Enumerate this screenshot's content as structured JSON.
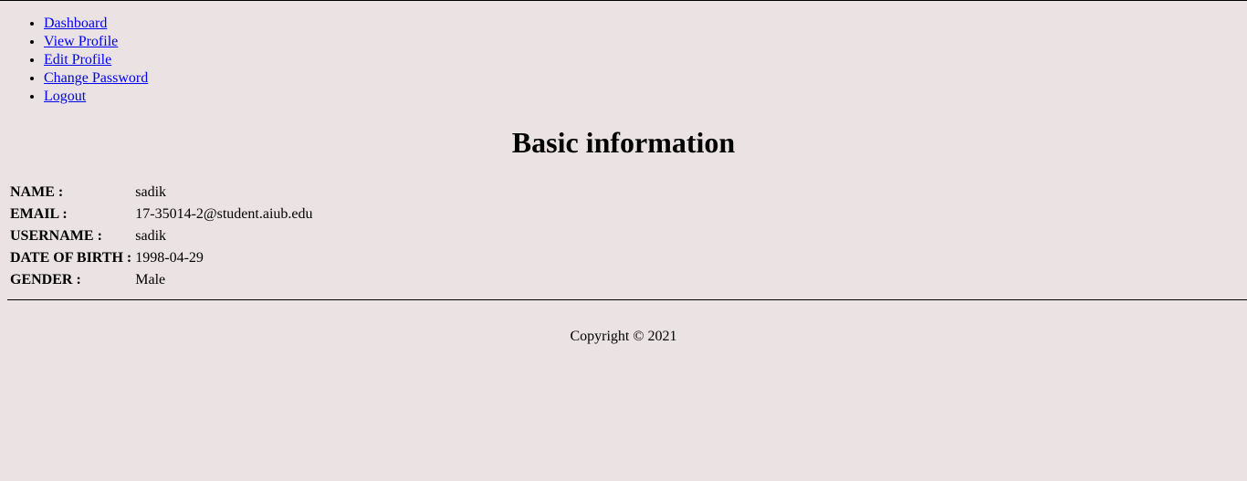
{
  "nav": {
    "items": [
      {
        "label": "Dashboard"
      },
      {
        "label": "View Profile"
      },
      {
        "label": "Edit Profile"
      },
      {
        "label": "Change Password"
      },
      {
        "label": "Logout"
      }
    ]
  },
  "main": {
    "title": "Basic information",
    "fields": [
      {
        "label": "NAME :",
        "value": "sadik"
      },
      {
        "label": "EMAIL :",
        "value": "17-35014-2@student.aiub.edu"
      },
      {
        "label": "USERNAME :",
        "value": "sadik"
      },
      {
        "label": "DATE OF BIRTH :",
        "value": "1998-04-29"
      },
      {
        "label": "GENDER :",
        "value": "Male"
      }
    ]
  },
  "footer": {
    "copyright": "Copyright © 2021"
  },
  "colors": {
    "background": "#ebe3e3",
    "link": "#0000ee",
    "text": "#000000"
  }
}
